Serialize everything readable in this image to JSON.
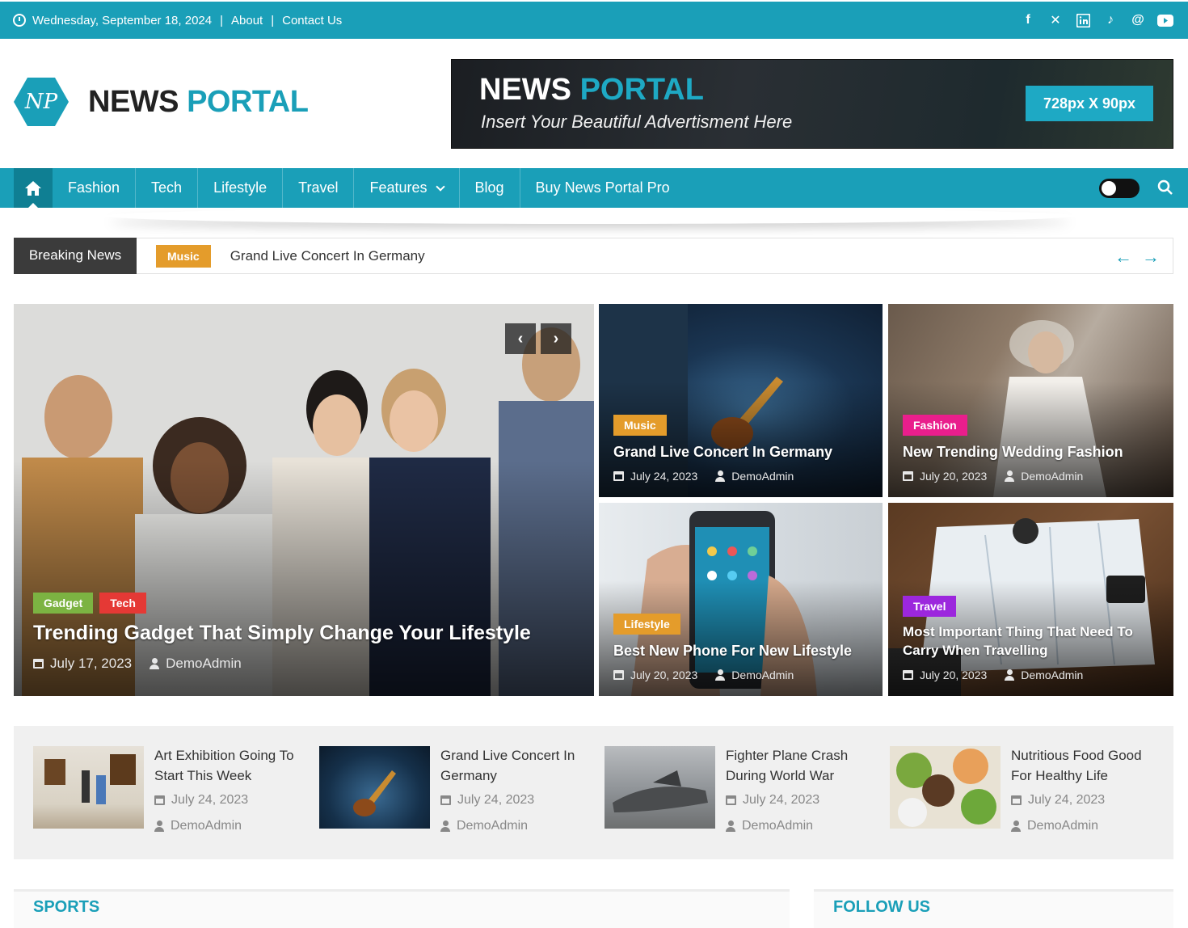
{
  "topbar": {
    "date": "Wednesday, September 18, 2024",
    "about": "About",
    "contact": "Contact Us",
    "social_icons": [
      "facebook-icon",
      "x-icon",
      "linkedin-icon",
      "tiktok-icon",
      "threads-icon",
      "youtube-icon"
    ]
  },
  "logo": {
    "mark": "NP",
    "word1": "NEWS",
    "word2": "PORTAL"
  },
  "ad": {
    "word1": "NEWS",
    "word2": "PORTAL",
    "subtitle": "Insert Your Beautiful Advertisment Here",
    "size": "728px X 90px"
  },
  "nav": {
    "items": [
      "Fashion",
      "Tech",
      "Lifestyle",
      "Travel",
      "Features",
      "Blog",
      "Buy News Portal Pro"
    ]
  },
  "breaking": {
    "label": "Breaking News",
    "category": "Music",
    "headline": "Grand Live Concert In Germany"
  },
  "featured": {
    "main": {
      "badges": [
        "Gadget",
        "Tech"
      ],
      "title": "Trending Gadget That Simply Change Your Lifestyle",
      "date": "July 17, 2023",
      "author": "DemoAdmin"
    },
    "tiles": [
      {
        "badge": "Music",
        "title": "Grand Live Concert In Germany",
        "date": "July 24, 2023",
        "author": "DemoAdmin"
      },
      {
        "badge": "Fashion",
        "title": "New Trending Wedding Fashion",
        "date": "July 20, 2023",
        "author": "DemoAdmin"
      },
      {
        "badge": "Lifestyle",
        "title": "Best New Phone For New Lifestyle",
        "date": "July 20, 2023",
        "author": "DemoAdmin"
      },
      {
        "badge": "Travel",
        "title": "Most Important Thing That Need To Carry When Travelling",
        "date": "July 20, 2023",
        "author": "DemoAdmin"
      }
    ]
  },
  "row": [
    {
      "title": "Art Exhibition Going To Start This Week",
      "date": "July 24, 2023",
      "author": "DemoAdmin"
    },
    {
      "title": "Grand Live Concert In Germany",
      "date": "July 24, 2023",
      "author": "DemoAdmin"
    },
    {
      "title": "Fighter Plane Crash During World War",
      "date": "July 24, 2023",
      "author": "DemoAdmin"
    },
    {
      "title": "Nutritious Food Good For Healthy Life",
      "date": "July 24, 2023",
      "author": "DemoAdmin"
    }
  ],
  "sections": {
    "sports": "SPORTS",
    "follow": "FOLLOW US"
  },
  "colors": {
    "accent": "#1a9fb8",
    "music": "#e49c2b",
    "fashion": "#e91e8c",
    "travel": "#9c27dd",
    "gadget": "#7cb342",
    "tech": "#e53935"
  }
}
